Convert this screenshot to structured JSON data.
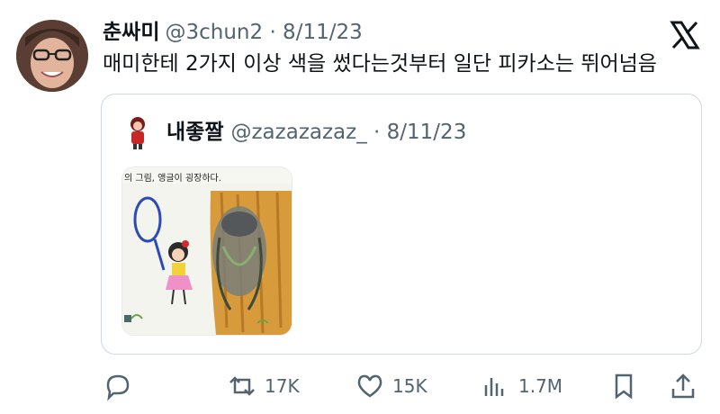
{
  "tweet": {
    "display_name": "춘싸미",
    "handle_date": "@3chun2 · 8/11/23",
    "text": "매미한테 2가지 이상 색을 썼다는것부터 일단 피카소는 뛰어넘음"
  },
  "quoted_tweet": {
    "display_name": "내좋짤",
    "handle_date": "@zazazazaz_ · 8/11/23",
    "image_caption": "의 그림, 앵글이 굉장하다."
  },
  "actions": {
    "retweets": "17K",
    "likes": "15K",
    "views": "1.7M"
  },
  "icons": [
    "x-logo-icon",
    "reply-icon",
    "retweet-icon",
    "like-icon",
    "views-icon",
    "bookmark-icon",
    "share-icon"
  ],
  "colors": {
    "text": "#0f1419",
    "muted": "#536471",
    "border": "#cfd9de"
  }
}
